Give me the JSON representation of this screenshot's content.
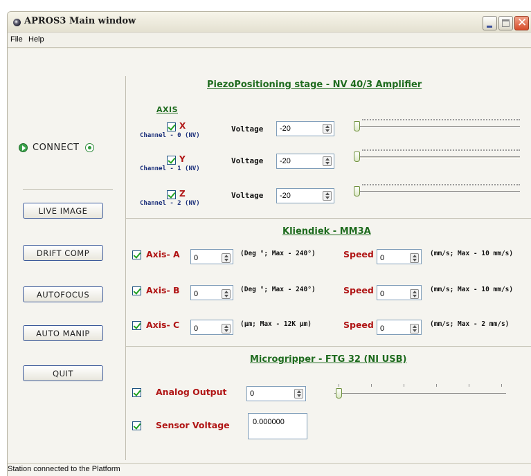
{
  "window": {
    "title": "APROS3 Main window"
  },
  "menu": {
    "file": "File",
    "help": "Help"
  },
  "left": {
    "connect_label": "CONNECT",
    "buttons": [
      "LIVE IMAGE",
      "DRIFT COMP",
      "AUTOFOCUS",
      "AUTO MANIP",
      "QUIT"
    ]
  },
  "piezo": {
    "title": "PiezoPositioning stage - NV 40/3 Amplifier",
    "axis_header": "AXIS",
    "rows": [
      {
        "axis": "X",
        "channel": "Channel - 0 (NV)",
        "voltage_label": "Voltage",
        "voltage": "-20",
        "checked": true,
        "slider_fraction": 0.0
      },
      {
        "axis": "Y",
        "channel": "Channel - 1 (NV)",
        "voltage_label": "Voltage",
        "voltage": "-20",
        "checked": true,
        "slider_fraction": 0.0
      },
      {
        "axis": "Z",
        "channel": "Channel - 2 (NV)",
        "voltage_label": "Voltage",
        "voltage": "-20",
        "checked": true,
        "slider_fraction": 0.0
      }
    ]
  },
  "kliendiek": {
    "title": "Kliendiek - MM3A",
    "rows": [
      {
        "axis": "Axis- A",
        "value": "0",
        "range": "(Deg °; Max - 240°)",
        "speed_label": "Speed",
        "speed": "0",
        "speed_range": "(mm/s; Max - 10 mm/s)",
        "checked": true
      },
      {
        "axis": "Axis- B",
        "value": "0",
        "range": "(Deg °; Max - 240°)",
        "speed_label": "Speed",
        "speed": "0",
        "speed_range": "(mm/s; Max - 10 mm/s)",
        "checked": true
      },
      {
        "axis": "Axis- C",
        "value": "0",
        "range": "(µm; Max - 12K µm)",
        "speed_label": "Speed",
        "speed": "0",
        "speed_range": "(mm/s; Max - 2 mm/s)",
        "checked": true
      }
    ]
  },
  "gripper": {
    "title": "Microgripper - FTG 32 (NI USB)",
    "analog_label": "Analog Output",
    "analog_value": "0",
    "analog_slider_fraction": 0.0,
    "sensor_label": "Sensor Voltage",
    "sensor_value": "0.000000"
  },
  "status": {
    "text": "Station connected to the Platform"
  },
  "colors": {
    "section_title": "#1e6b1e",
    "axis_label": "#b01515",
    "channel_label": "#1b2f7a"
  }
}
